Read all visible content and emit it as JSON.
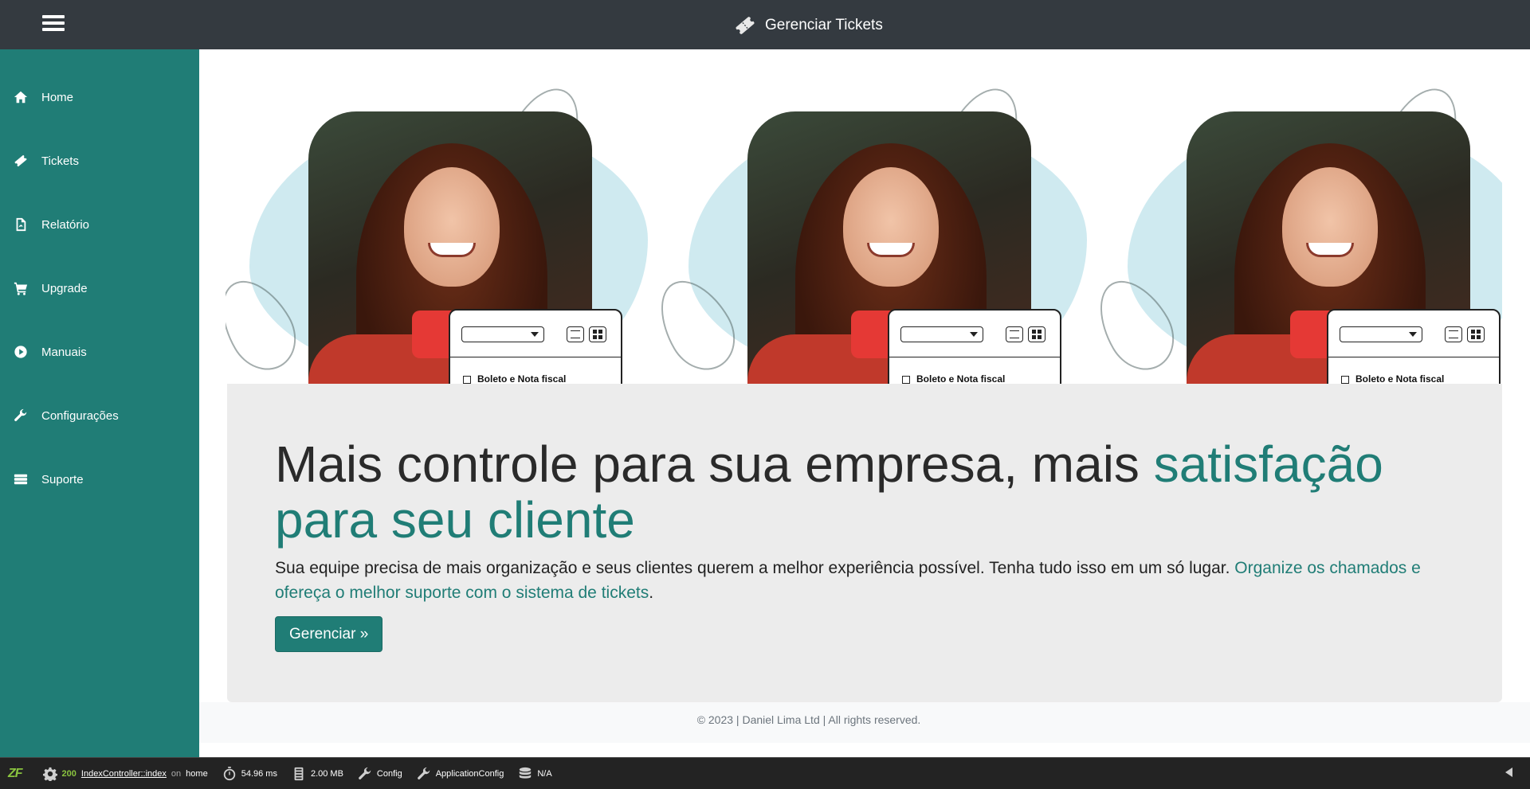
{
  "header": {
    "title": "Gerenciar Tickets",
    "brand_icon": "ticket-icon",
    "menu_icon": "hamburger-icon"
  },
  "sidebar": {
    "items": [
      {
        "label": "Home",
        "icon": "home-icon"
      },
      {
        "label": "Tickets",
        "icon": "ticket-icon"
      },
      {
        "label": "Relatório",
        "icon": "pdf-file-icon"
      },
      {
        "label": "Upgrade",
        "icon": "cart-icon"
      },
      {
        "label": "Manuais",
        "icon": "play-circle-icon"
      },
      {
        "label": "Configurações",
        "icon": "wrench-icon"
      },
      {
        "label": "Suporte",
        "icon": "server-icon"
      }
    ]
  },
  "hero": {
    "card_checkbox_label": "Boleto e Nota fiscal"
  },
  "jumbotron": {
    "headline_part1": "Mais controle para sua empresa, mais ",
    "headline_accent": "satisfação para seu cliente",
    "lead_part1": "Sua equipe precisa de mais organização e seus clientes querem a melhor experiência possível. Tenha tudo isso em um só lugar. ",
    "lead_accent": "Organize os chamados e ofereça o melhor suporte com o sistema de tickets",
    "lead_end": ".",
    "cta_label": "Gerenciar »"
  },
  "footer": {
    "text": "© 2023 | Daniel Lima Ltd | All rights reserved."
  },
  "devbar": {
    "logo": "ZF",
    "status_code": "200",
    "controller": "IndexController::index",
    "on_text": "on",
    "route": "home",
    "time": "54.96 ms",
    "memory": "2.00 MB",
    "config": "Config",
    "app_config": "ApplicationConfig",
    "db": "N/A"
  },
  "colors": {
    "accent": "#207d76",
    "topbar": "#343a40",
    "jumbotron_bg": "#ececec"
  }
}
